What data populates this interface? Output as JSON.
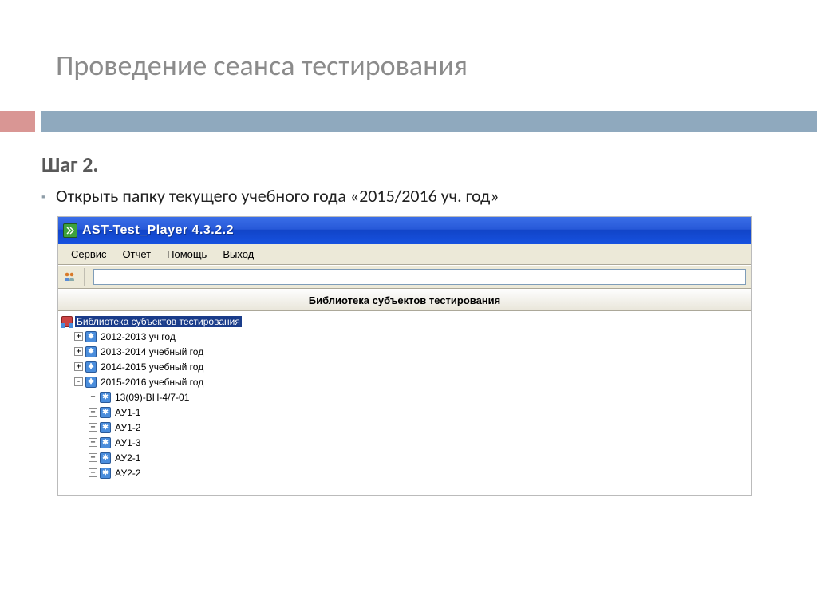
{
  "slide": {
    "title": "Проведение сеанса тестирования",
    "step": "Шаг 2.",
    "instruction": "Открыть папку текущего учебного года «2015/2016 уч. год»"
  },
  "app": {
    "window_title": "AST-Test_Player  4.3.2.2",
    "menu": {
      "service": "Сервис",
      "report": "Отчет",
      "help": "Помощь",
      "exit": "Выход"
    },
    "panel_title": "Библиотека субъектов тестирования",
    "tree": {
      "root": "Библиотека субъектов тестирования",
      "years": [
        {
          "label": "2012-2013 уч год",
          "expanded": false
        },
        {
          "label": "2013-2014 учебный год",
          "expanded": false
        },
        {
          "label": "2014-2015 учебный год",
          "expanded": false
        },
        {
          "label": "2015-2016 учебный год",
          "expanded": true,
          "children": [
            {
              "label": "13(09)-ВН-4/7-01"
            },
            {
              "label": "АУ1-1"
            },
            {
              "label": "АУ1-2"
            },
            {
              "label": "АУ1-3"
            },
            {
              "label": "АУ2-1"
            },
            {
              "label": "АУ2-2"
            }
          ]
        }
      ]
    }
  }
}
